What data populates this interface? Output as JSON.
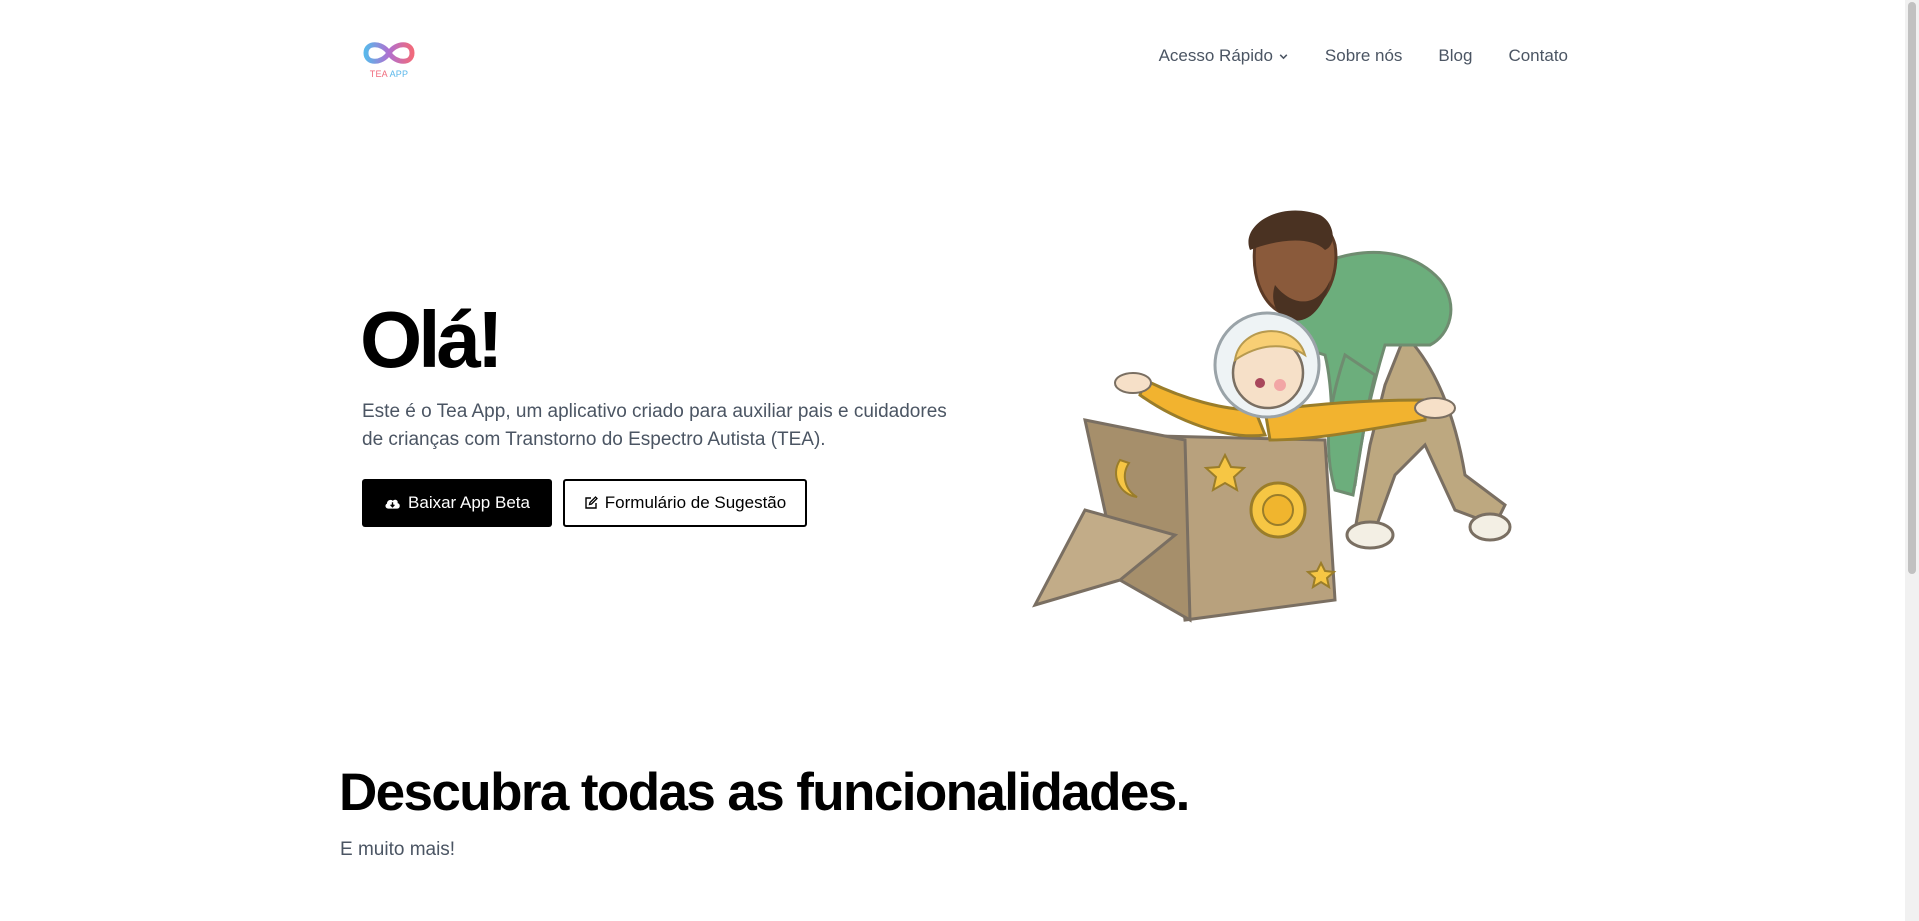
{
  "header": {
    "logo": {
      "text_part1": "TEA",
      "text_part2": "APP",
      "icon": "infinity-logo-icon"
    },
    "nav": [
      {
        "label": "Acesso Rápido",
        "has_dropdown": true,
        "icon": "chevron-down-icon"
      },
      {
        "label": "Sobre nós"
      },
      {
        "label": "Blog"
      },
      {
        "label": "Contato"
      }
    ]
  },
  "hero": {
    "title": "Olá!",
    "description": "Este é o Tea App, um aplicativo criado para auxiliar pais e cuidadores de crianças com Transtorno do Espectro Autista (TEA).",
    "primary_button": {
      "label": "Baixar App Beta",
      "icon": "cloud-download-icon"
    },
    "secondary_button": {
      "label": "Formulário de Sugestão",
      "icon": "edit-icon"
    },
    "illustration": "father-and-child-playing-astronaut-box-illustration"
  },
  "features": {
    "title": "Descubra todas as funcionalidades.",
    "subtitle": "E muito mais!"
  },
  "colors": {
    "logo_pink": "#f06a7c",
    "logo_blue": "#5ab7ea",
    "text_muted": "#4b5563",
    "button_dark": "#000000"
  }
}
